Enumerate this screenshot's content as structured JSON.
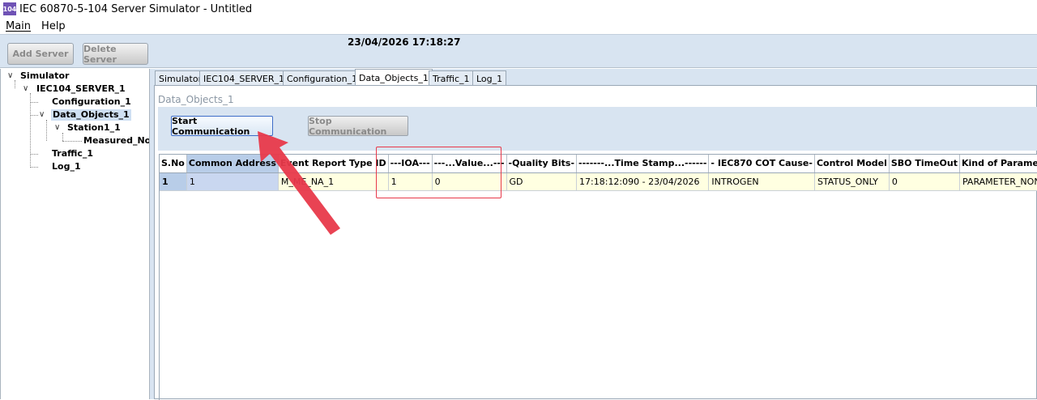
{
  "window": {
    "icon_text": "104",
    "title": "IEC 60870-5-104 Server Simulator - Untitled"
  },
  "menu": [
    {
      "label": "Main"
    },
    {
      "label": "Help"
    }
  ],
  "toolbar": {
    "add_server": "Add Server",
    "delete_server": "Delete Server",
    "datetime": "23/04/2026 17:18:27"
  },
  "tree": {
    "root": "Simulator",
    "server": "IEC104_SERVER_1",
    "configuration": "Configuration_1",
    "data_objects": "Data_Objects_1",
    "station": "Station1_1",
    "measured": "Measured_Nor",
    "traffic": "Traffic_1",
    "log": "Log_1"
  },
  "tabs": [
    {
      "label": "Simulator"
    },
    {
      "label": "IEC104_SERVER_1"
    },
    {
      "label": "Configuration_1"
    },
    {
      "label": "Data_Objects_1"
    },
    {
      "label": "Traffic_1"
    },
    {
      "label": "Log_1"
    }
  ],
  "panel": {
    "title": "Data_Objects_1",
    "start_label": "Start Communication",
    "stop_label": "Stop Communication"
  },
  "table": {
    "headers": [
      "S.No",
      "Common Address",
      "Event Report Type ID",
      "---IOA---",
      "---...Value...---",
      "-Quality Bits-",
      "-------...Time Stamp...------",
      "-  IEC870 COT Cause-",
      "Control Model",
      "SBO TimeOut",
      "Kind of Parameter -"
    ],
    "rows": [
      [
        "1",
        "1",
        "M_ME_NA_1",
        "1",
        "0",
        "GD",
        "17:18:12:090 - 23/04/2026",
        "INTROGEN",
        "STATUS_ONLY",
        "0",
        "PARAMETER_NONE"
      ]
    ]
  },
  "annotation_color": "#e8394a"
}
